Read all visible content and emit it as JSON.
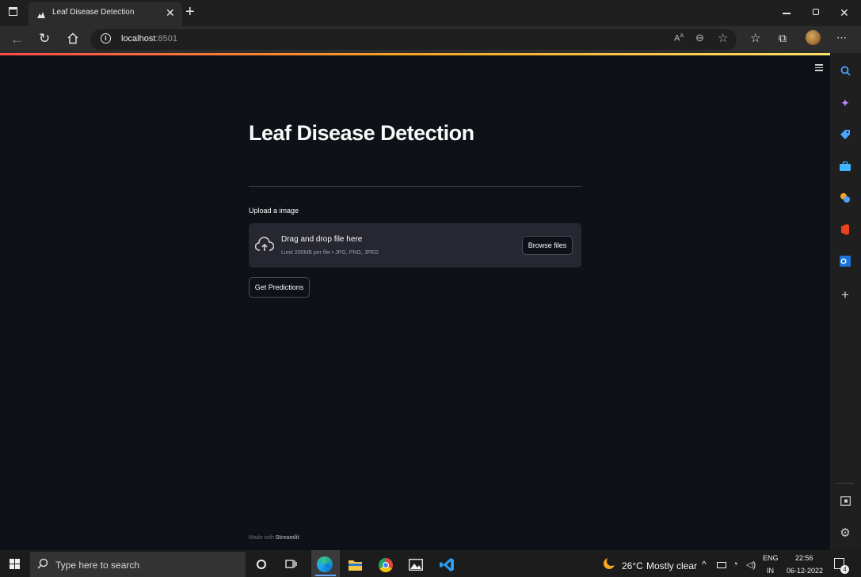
{
  "browser": {
    "tab_title": "Leaf Disease Detection",
    "url_host": "localhost",
    "url_port": ":8501"
  },
  "page": {
    "title": "Leaf Disease Detection",
    "upload_label": "Upload a image",
    "dropzone": {
      "main_text": "Drag and drop file here",
      "limit_text": "Limit 200MB per file • JPG, PNG, JPEG",
      "browse_label": "Browse files"
    },
    "predict_label": "Get Predictions",
    "footer_prefix": "Made with ",
    "footer_brand": "Streamlit"
  },
  "taskbar": {
    "search_placeholder": "Type here to search",
    "weather_temp": "26°C",
    "weather_text": "Mostly clear",
    "lang_top": "ENG",
    "lang_bottom": "IN",
    "time": "22:56",
    "date": "06-12-2022",
    "notif_count": "4"
  },
  "colors": {
    "page_bg": "#0e1117",
    "dropzone_bg": "#262730",
    "accent_gradient_start": "#ff4b4b",
    "accent_gradient_end": "#ffe066"
  }
}
